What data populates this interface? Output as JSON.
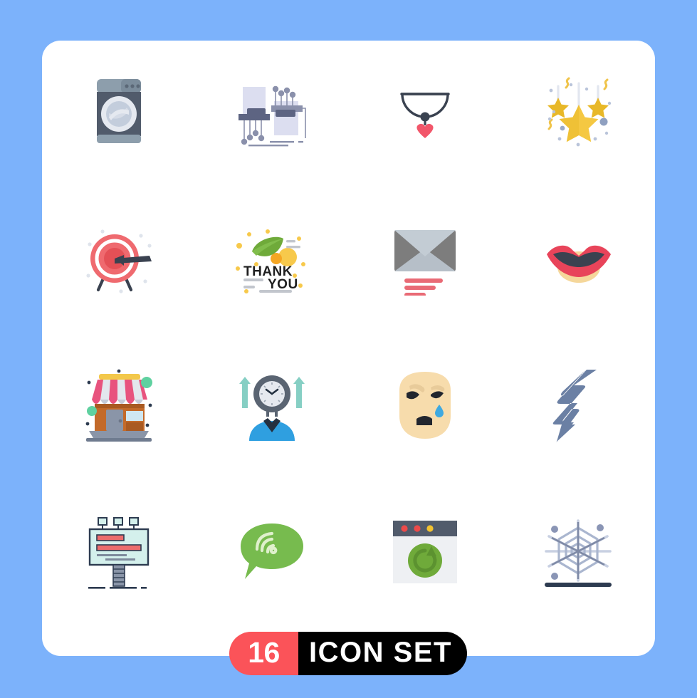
{
  "background_color": "#7cb2fb",
  "card": {
    "background_color": "#ffffff"
  },
  "banner": {
    "count": "16",
    "label": "ICON SET",
    "count_bg": "#fb5359",
    "label_bg": "#000000",
    "text_color": "#ffffff"
  },
  "icons": [
    {
      "name": "washing-machine-icon",
      "label": "Washing Machine",
      "colors": [
        "#8d9eac",
        "#515b6b",
        "#e5e9f0",
        "#aab8c6"
      ]
    },
    {
      "name": "circuit-board-icon",
      "label": "Circuit Board",
      "colors": [
        "#dcdef0",
        "#5d6482",
        "#8a90ab"
      ]
    },
    {
      "name": "necklace-heart-icon",
      "label": "Necklace",
      "colors": [
        "#3a4250",
        "#f2566a"
      ]
    },
    {
      "name": "hanging-stars-icon",
      "label": "Hanging Stars",
      "colors": [
        "#f5c842",
        "#e8b828",
        "#d8dde8",
        "#8fa0c0"
      ]
    },
    {
      "name": "target-arrow-icon",
      "label": "Target",
      "colors": [
        "#ef6a6f",
        "#e45056",
        "#3a4250",
        "#ffffff"
      ]
    },
    {
      "name": "thank-you-card-icon",
      "label": "Thank You Card",
      "colors": [
        "#6faa3a",
        "#f5a623",
        "#f7c94b",
        "#1f1f1f",
        "#b9bdc4"
      ]
    },
    {
      "name": "send-mail-icon",
      "label": "Send Mail",
      "colors": [
        "#7d7d7d",
        "#b6bfc8",
        "#e96a75"
      ]
    },
    {
      "name": "lips-icon",
      "label": "Lips",
      "colors": [
        "#e8445a",
        "#f5d79b",
        "#3a4250"
      ]
    },
    {
      "name": "shop-store-icon",
      "label": "Shop",
      "colors": [
        "#e8537e",
        "#e3e7ee",
        "#f3c84b",
        "#c36a2a",
        "#8a95a8",
        "#5fd1a0",
        "#2d3b50"
      ]
    },
    {
      "name": "time-management-icon",
      "label": "Time Management",
      "colors": [
        "#2f9fe0",
        "#5a6472",
        "#e6e9ef",
        "#86cfc4",
        "#243040"
      ]
    },
    {
      "name": "crying-face-icon",
      "label": "Crying Face",
      "colors": [
        "#f7dcac",
        "#22262e",
        "#3fa9e0"
      ]
    },
    {
      "name": "lightning-bolt-icon",
      "label": "Lightning Bolt",
      "colors": [
        "#6b80a4"
      ]
    },
    {
      "name": "billboard-icon",
      "label": "Billboard",
      "colors": [
        "#d4f0ec",
        "#2d3b50",
        "#ec6d6d",
        "#8a95a8",
        "#7e8a9c"
      ]
    },
    {
      "name": "chat-signal-icon",
      "label": "Chat Bubble",
      "colors": [
        "#77bb4e",
        "#dff0cc"
      ]
    },
    {
      "name": "browser-refresh-icon",
      "label": "Browser Refresh",
      "colors": [
        "#515b6b",
        "#eef0f3",
        "#ec4a4a",
        "#f2c230",
        "#6faa3a"
      ]
    },
    {
      "name": "spider-web-icon",
      "label": "Spider Web",
      "colors": [
        "#aab6cf",
        "#c8d0e2",
        "#7f8aa6",
        "#2d3b50"
      ]
    }
  ]
}
